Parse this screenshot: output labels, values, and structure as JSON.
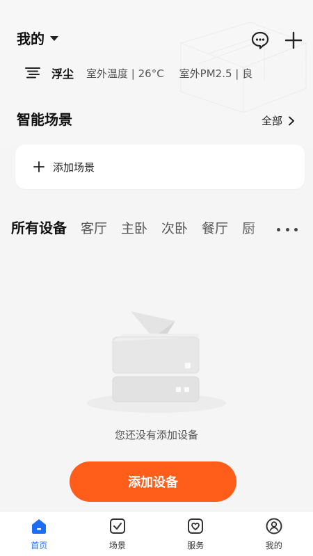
{
  "header": {
    "home_name": "我的",
    "weather_condition": "浮尘",
    "outdoor_temp": "室外温度 | 26°C",
    "outdoor_pm25": "室外PM2.5 | 良"
  },
  "scenes": {
    "title": "智能场景",
    "view_all": "全部",
    "add_scene": "添加场景"
  },
  "rooms": {
    "tabs": [
      "所有设备",
      "客厅",
      "主卧",
      "次卧",
      "餐厅",
      "厨"
    ]
  },
  "empty_state": {
    "message": "您还没有添加设备",
    "button": "添加设备"
  },
  "bottom_nav": {
    "items": [
      {
        "label": "首页",
        "icon": "home-icon"
      },
      {
        "label": "场景",
        "icon": "scene-icon"
      },
      {
        "label": "服务",
        "icon": "service-icon"
      },
      {
        "label": "我的",
        "icon": "profile-icon"
      }
    ]
  },
  "colors": {
    "accent": "#ff5d1a",
    "nav_active": "#1e6ef5",
    "background": "#f5f5f5"
  }
}
